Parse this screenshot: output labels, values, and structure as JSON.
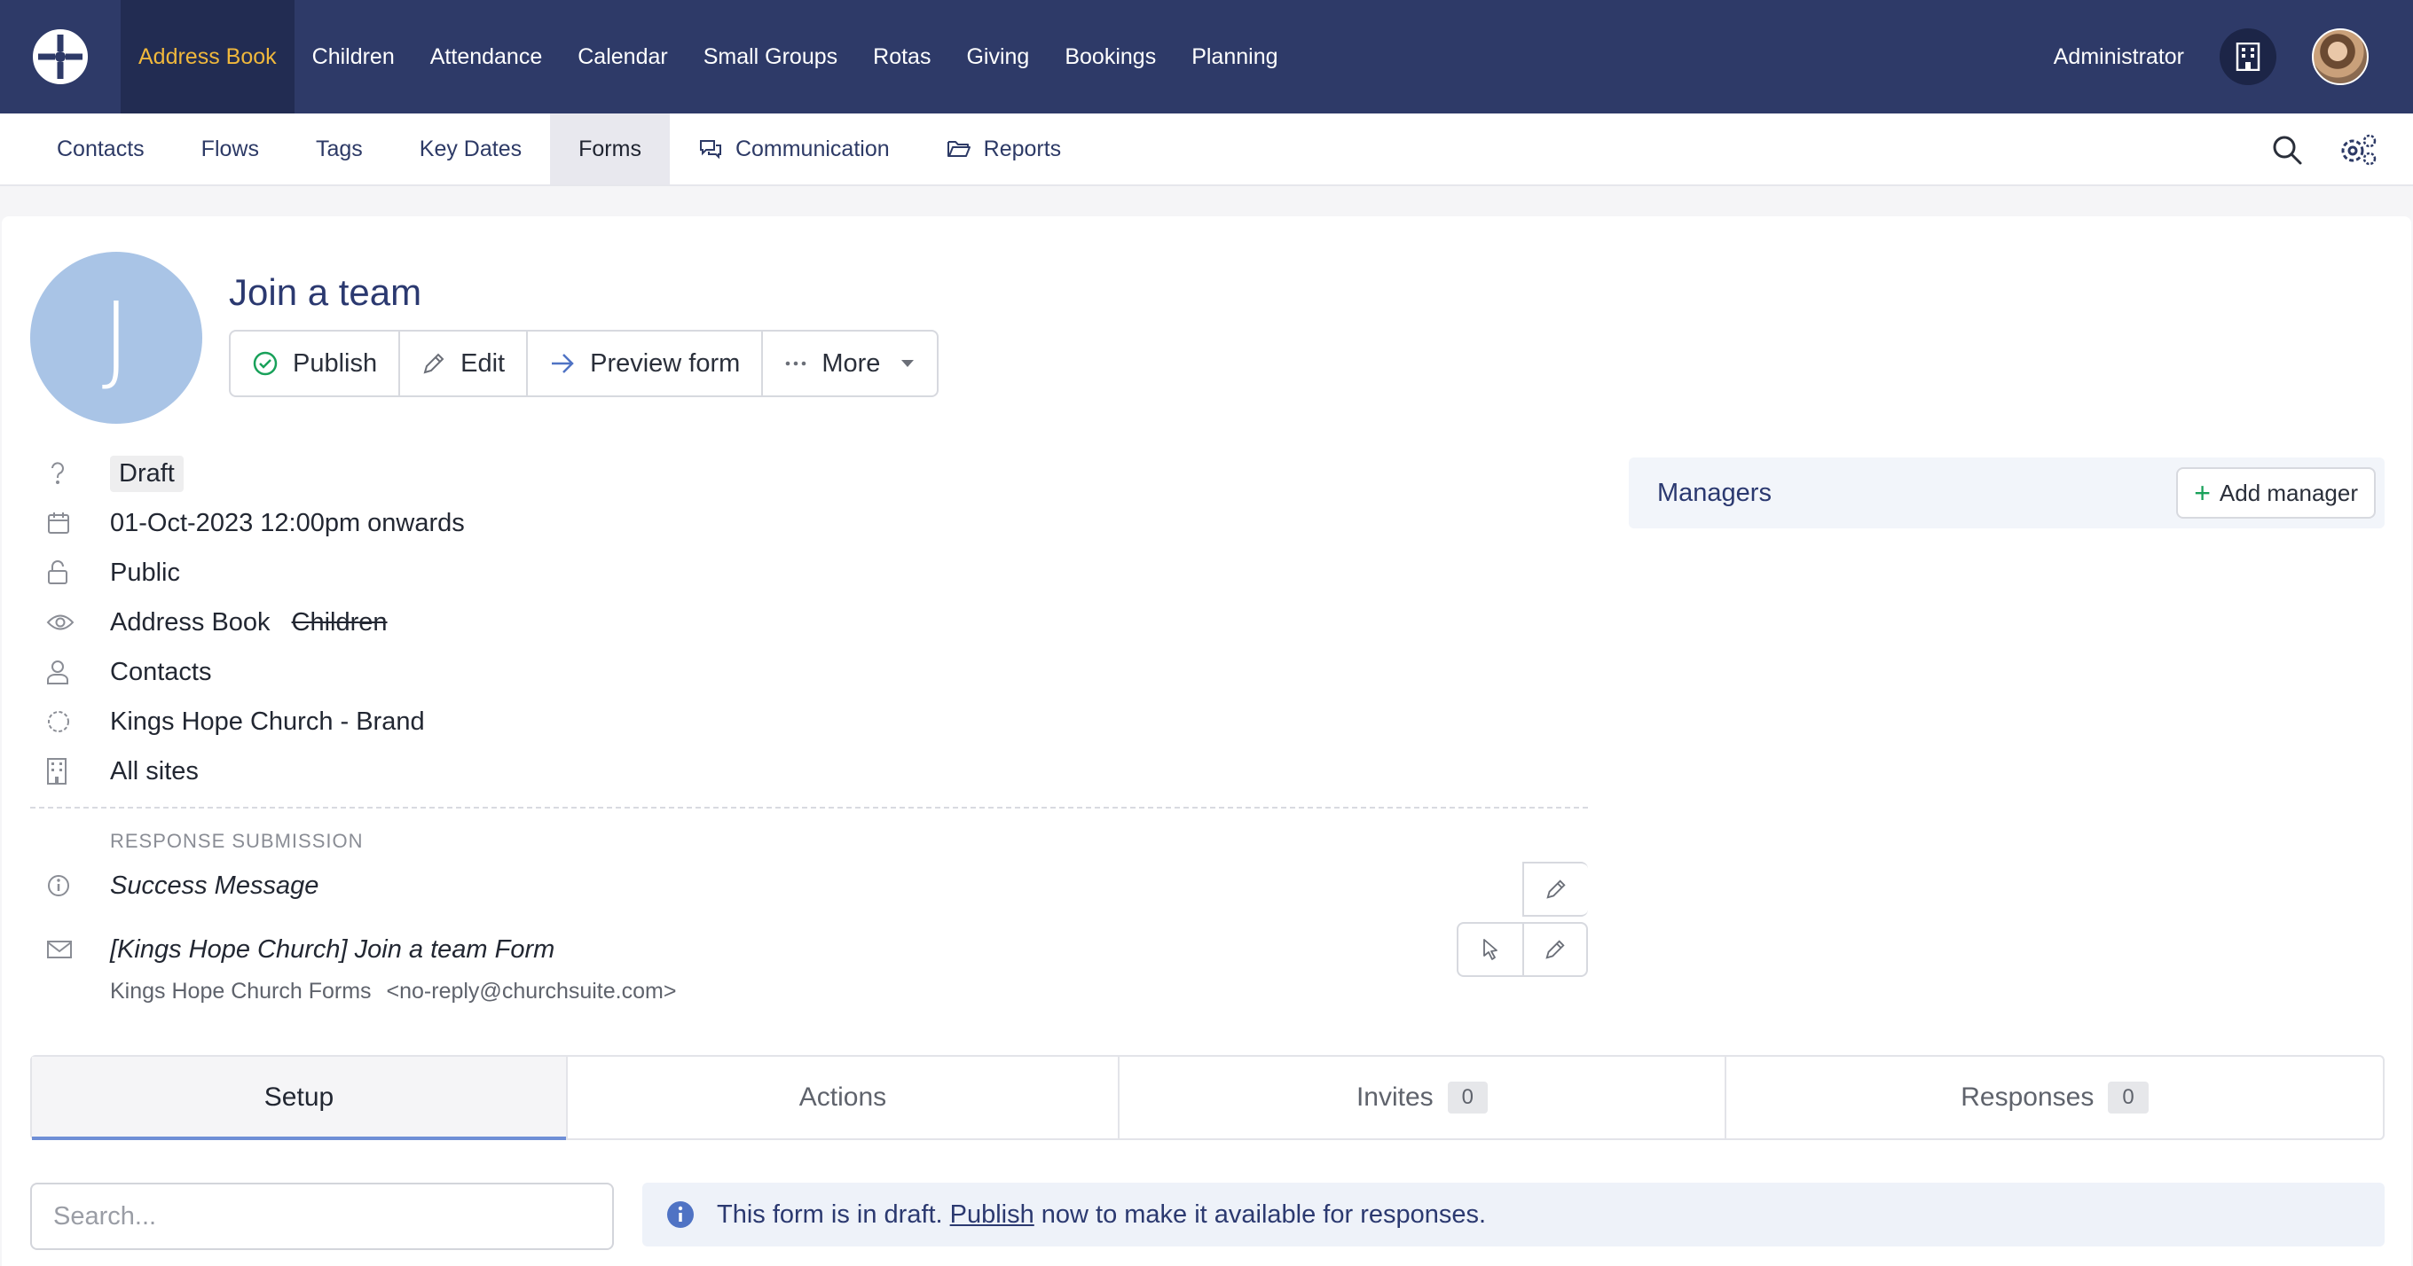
{
  "topnav": {
    "items": [
      "Address Book",
      "Children",
      "Attendance",
      "Calendar",
      "Small Groups",
      "Rotas",
      "Giving",
      "Bookings",
      "Planning"
    ],
    "active": "Address Book",
    "user_label": "Administrator"
  },
  "subnav": {
    "items": [
      "Contacts",
      "Flows",
      "Tags",
      "Key Dates",
      "Forms",
      "Communication",
      "Reports"
    ],
    "active": "Forms"
  },
  "form": {
    "avatar_letter": "J",
    "title": "Join a team",
    "buttons": {
      "publish": "Publish",
      "edit": "Edit",
      "preview": "Preview form",
      "more": "More"
    },
    "status": "Draft",
    "date": "01-Oct-2023 12:00pm onwards",
    "visibility": "Public",
    "modules": {
      "enabled": "Address Book",
      "disabled": "Children"
    },
    "audience": "Contacts",
    "brand": {
      "name": "Kings Hope Church",
      "suffix": "- Brand"
    },
    "sites": "All sites",
    "response_section_label": "RESPONSE SUBMISSION",
    "success_message": "Success Message",
    "email": {
      "subject": "[Kings Hope Church] Join a team Form",
      "sender_name": "Kings Hope Church Forms",
      "sender_address": "<no-reply@churchsuite.com>"
    }
  },
  "managers": {
    "title": "Managers",
    "add_label": "Add manager"
  },
  "tabs": [
    {
      "label": "Setup"
    },
    {
      "label": "Actions"
    },
    {
      "label": "Invites",
      "count": "0"
    },
    {
      "label": "Responses",
      "count": "0"
    }
  ],
  "search": {
    "placeholder": "Search..."
  },
  "banner": {
    "before": "This form is in draft.",
    "link": "Publish",
    "after": "now to make it available for responses."
  },
  "colors": {
    "nav_bg": "#2e3a68",
    "nav_active_text": "#f0b83c",
    "accent_green": "#19a15a",
    "title_blue": "#2b3970"
  }
}
